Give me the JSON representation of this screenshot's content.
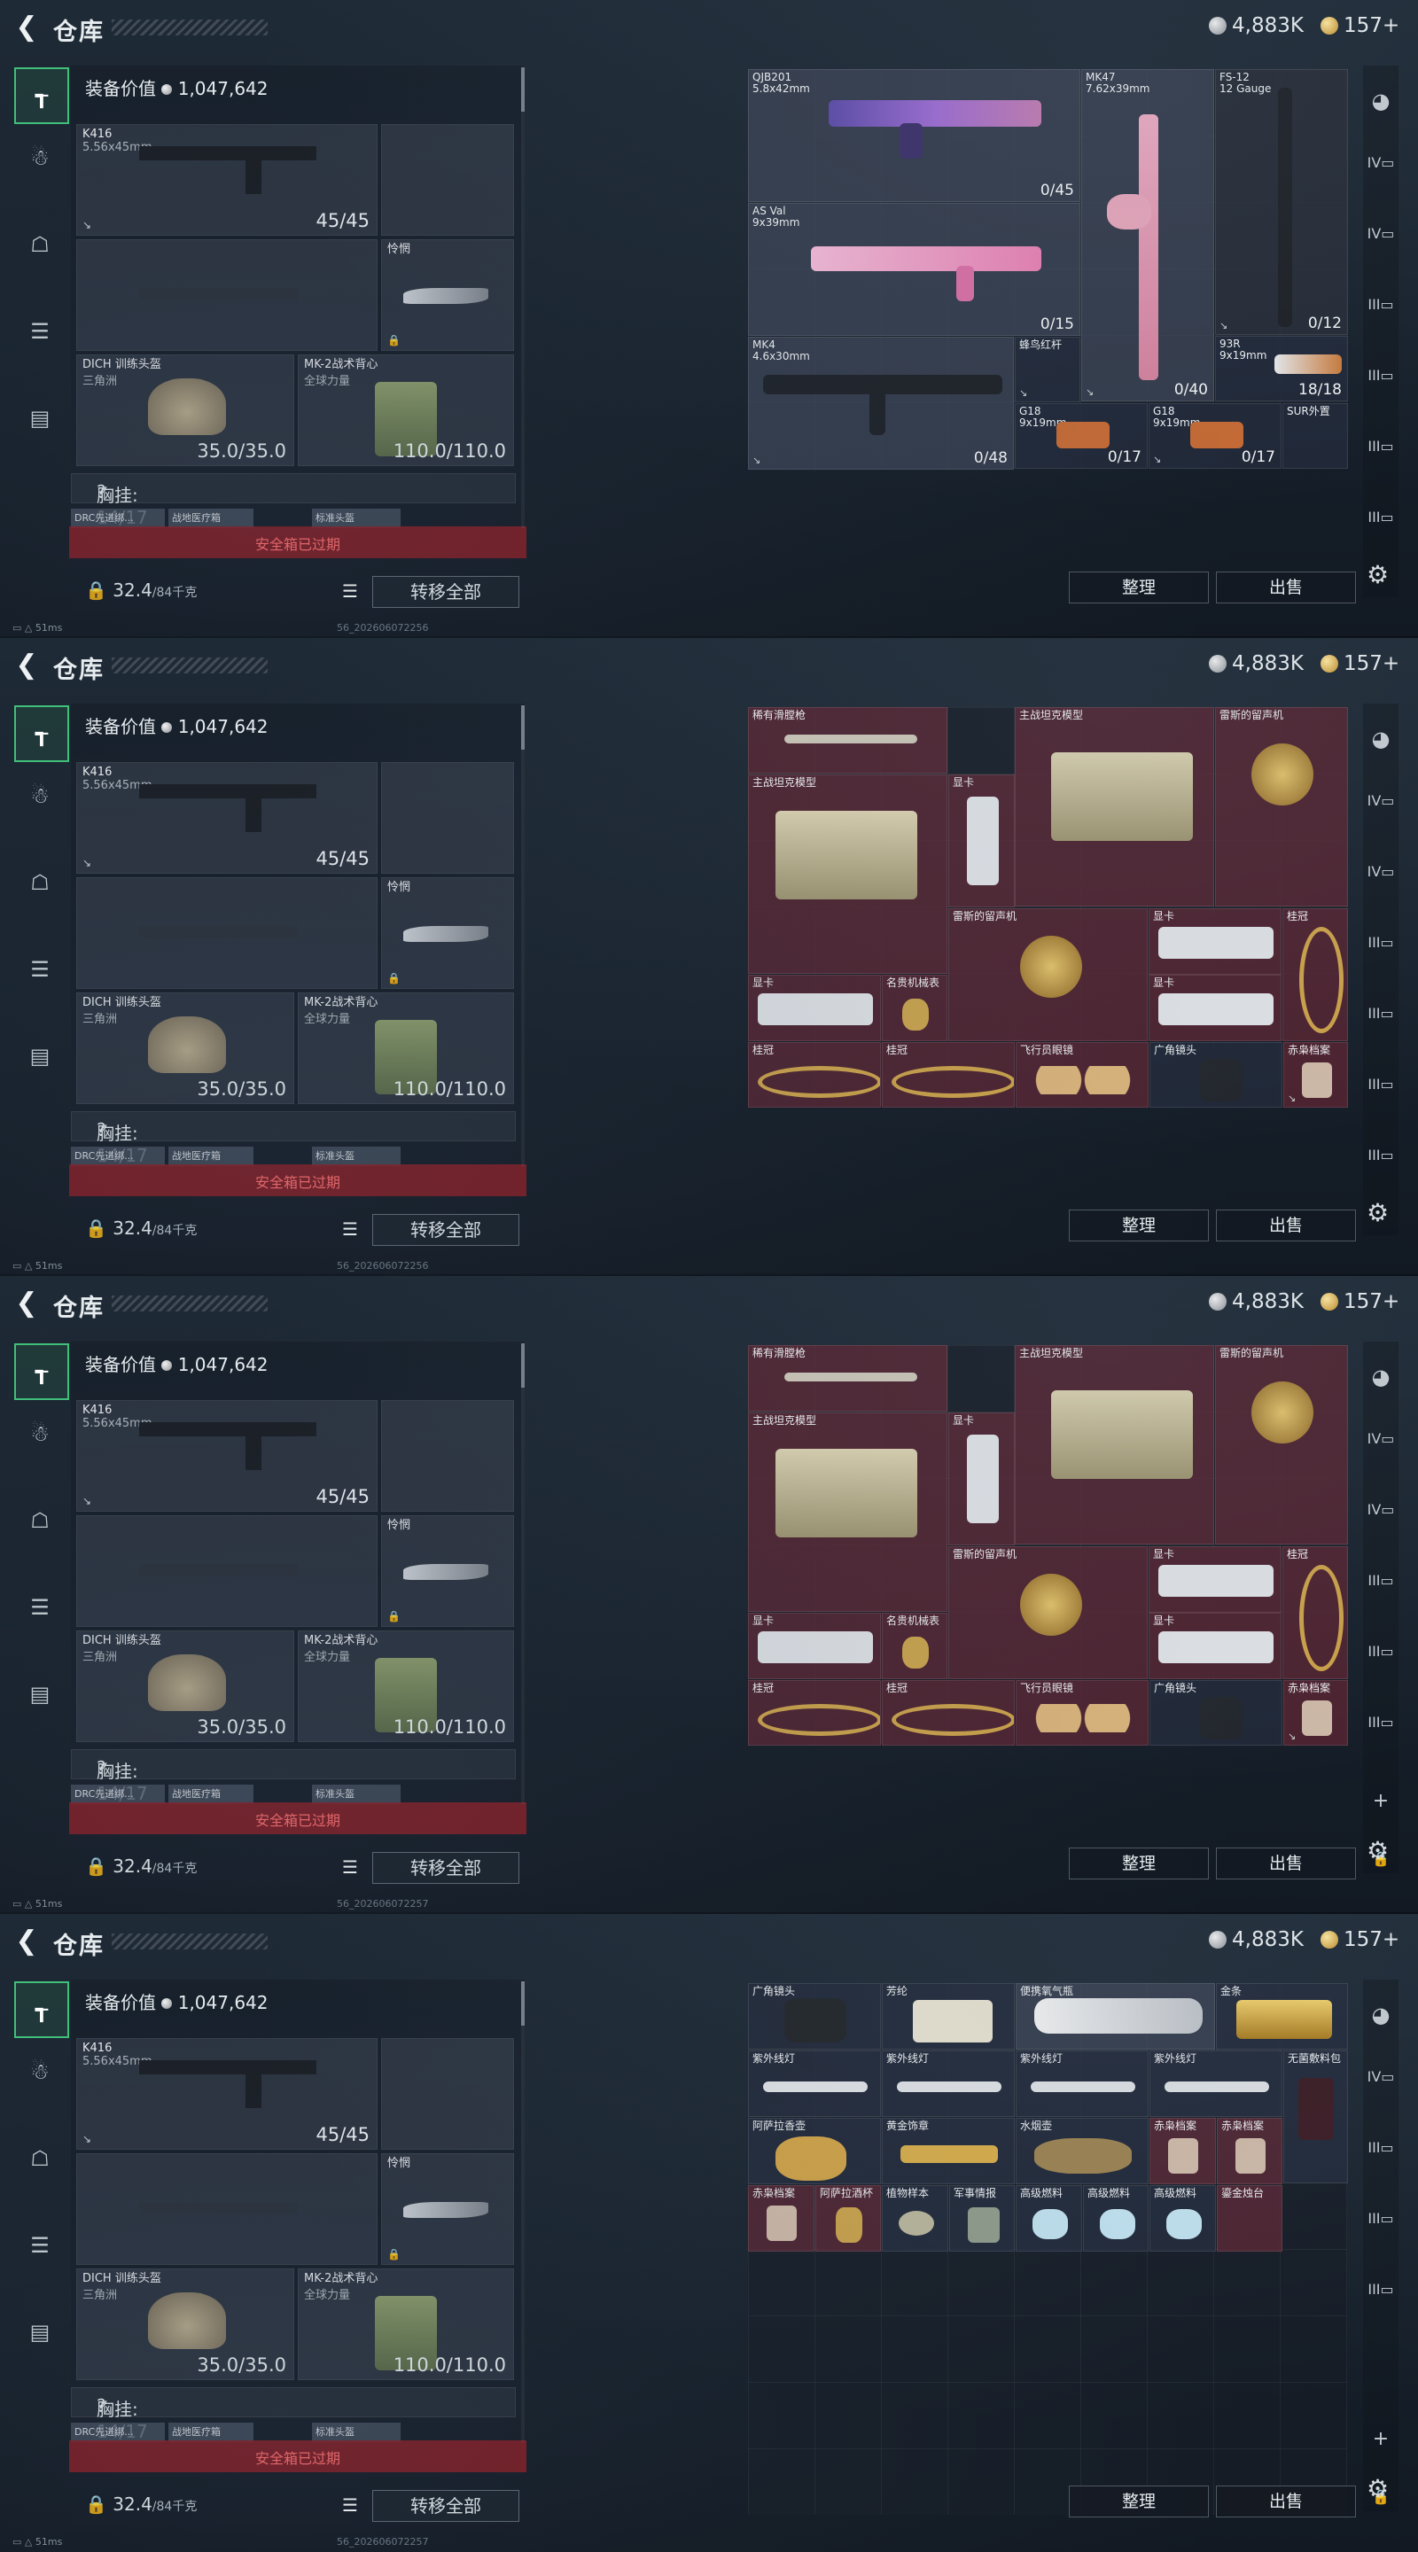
{
  "header": {
    "title": "仓库",
    "silver": "4,883K",
    "gold": "157+"
  },
  "left": {
    "equip_value_label": "装备价值",
    "equip_value": "1,047,642",
    "primary_name": "K416",
    "primary_caliber": "5.56x45mm",
    "primary_ammo": "45/45",
    "melee_name": "怜惘",
    "helmet_name": "DICH 训练头盔",
    "helmet_sub": "三角洲",
    "helmet_dur": "35.0/35.0",
    "vest_name": "MK-2战术背心",
    "vest_sub": "全球力量",
    "vest_dur": "110.0/110.0",
    "rig_label": "胸挂: 14/17",
    "rig_q": "?",
    "mini": [
      "DRC先进绑...",
      "战地医疗箱",
      "标准头盔"
    ],
    "safe_box": "安全箱已过期",
    "weight": "32.4",
    "weight_max": "/84千克",
    "transfer": "转移全部"
  },
  "actions": {
    "sort": "整理",
    "sell": "出售"
  },
  "status": {
    "ping": "51ms",
    "build1": "56_202606072256",
    "build2": "56_202606072257"
  },
  "grid_weapons": [
    {
      "name": "QJB201\n5.8x42mm",
      "count": "0/45"
    },
    {
      "name": "MK47\n7.62x39mm",
      "count": "0/40"
    },
    {
      "name": "FS-12\n12 Gauge",
      "count": "0/12"
    },
    {
      "name": "AS Val\n9x39mm",
      "count": "0/15"
    },
    {
      "name": "MK4\n4.6x30mm",
      "count": "0/48"
    },
    {
      "name": "蜂鸟红杆",
      "count": ""
    },
    {
      "name": "93R\n9x19mm",
      "count": "18/18"
    },
    {
      "name": "G18\n9x19mm",
      "count": "0/17"
    },
    {
      "name": "G18\n9x19mm",
      "count": "0/17"
    },
    {
      "name": "SUR外置",
      "count": ""
    }
  ],
  "grid_loot": [
    {
      "name": "稀有滑膛枪"
    },
    {
      "name": "主战坦克模型"
    },
    {
      "name": "雷斯的留声机"
    },
    {
      "name": "主战坦克模型"
    },
    {
      "name": "显卡"
    },
    {
      "name": "雷斯的留声机"
    },
    {
      "name": "显卡"
    },
    {
      "name": "桂冠"
    },
    {
      "name": "显卡"
    },
    {
      "name": "名贵机械表"
    },
    {
      "name": "显卡"
    },
    {
      "name": "桂冠"
    },
    {
      "name": "桂冠"
    },
    {
      "name": "飞行员眼镜"
    },
    {
      "name": "广角镜头"
    },
    {
      "name": "赤枭档案"
    }
  ],
  "grid_misc": [
    {
      "name": "广角镜头"
    },
    {
      "name": "芳纶"
    },
    {
      "name": "便携氧气瓶"
    },
    {
      "name": "金条"
    },
    {
      "name": "紫外线灯"
    },
    {
      "name": "紫外线灯"
    },
    {
      "name": "紫外线灯"
    },
    {
      "name": "紫外线灯"
    },
    {
      "name": "无菌敷料包"
    },
    {
      "name": "阿萨拉香壶"
    },
    {
      "name": "黄金饰章"
    },
    {
      "name": "水烟壶"
    },
    {
      "name": "赤枭档案"
    },
    {
      "name": "赤枭档案"
    },
    {
      "name": "赤枭档案"
    },
    {
      "name": "阿萨拉酒杯"
    },
    {
      "name": "植物样本"
    },
    {
      "name": "军事情报"
    },
    {
      "name": "高级燃料"
    },
    {
      "name": "高级燃料"
    },
    {
      "name": "高级燃料"
    },
    {
      "name": "鎏金烛台"
    }
  ],
  "icons": {
    "back": "chevron-left-icon",
    "settings": "gear-icon",
    "lock": "lock-icon",
    "list": "list-icon"
  }
}
